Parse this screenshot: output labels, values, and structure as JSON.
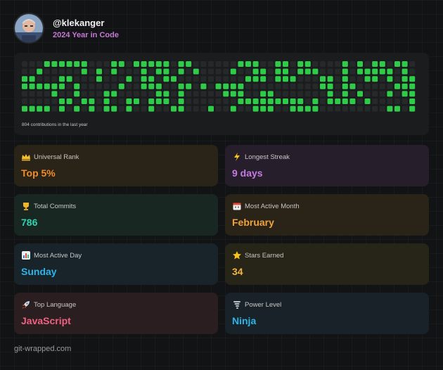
{
  "header": {
    "username": "@klekanger",
    "subtitle": "2024 Year in Code"
  },
  "contributions": {
    "caption": "804 contributions in the last year",
    "cell_color_active": "#2fcc4a",
    "cell_color_inactive": "#25292a"
  },
  "cards": [
    {
      "label": "Universal Rank",
      "value": "Top 5%",
      "icon": "crown-icon",
      "accent": "#f28c28",
      "bg": "#2a2317"
    },
    {
      "label": "Longest Streak",
      "value": "9 days",
      "icon": "lightning-icon",
      "accent": "#c67be3",
      "bg": "#261f2b"
    },
    {
      "label": "Total Commits",
      "value": "786",
      "icon": "trophy-icon",
      "accent": "#2ed1b2",
      "bg": "#182721"
    },
    {
      "label": "Most Active Month",
      "value": "February",
      "icon": "calendar-icon",
      "accent": "#f2a23c",
      "bg": "#292318"
    },
    {
      "label": "Most Active Day",
      "value": "Sunday",
      "icon": "bar-chart-icon",
      "accent": "#2bb5e8",
      "bg": "#18242a"
    },
    {
      "label": "Stars Earned",
      "value": "34",
      "icon": "star-icon",
      "accent": "#f2b63c",
      "bg": "#272418"
    },
    {
      "label": "Top Language",
      "value": "JavaScript",
      "icon": "rocket-icon",
      "accent": "#f0627f",
      "bg": "#2a1e21"
    },
    {
      "label": "Power Level",
      "value": "Ninja",
      "icon": "tornado-icon",
      "accent": "#2bb5e8",
      "bg": "#182228"
    }
  ],
  "footer": {
    "site": "git-wrapped.com"
  }
}
